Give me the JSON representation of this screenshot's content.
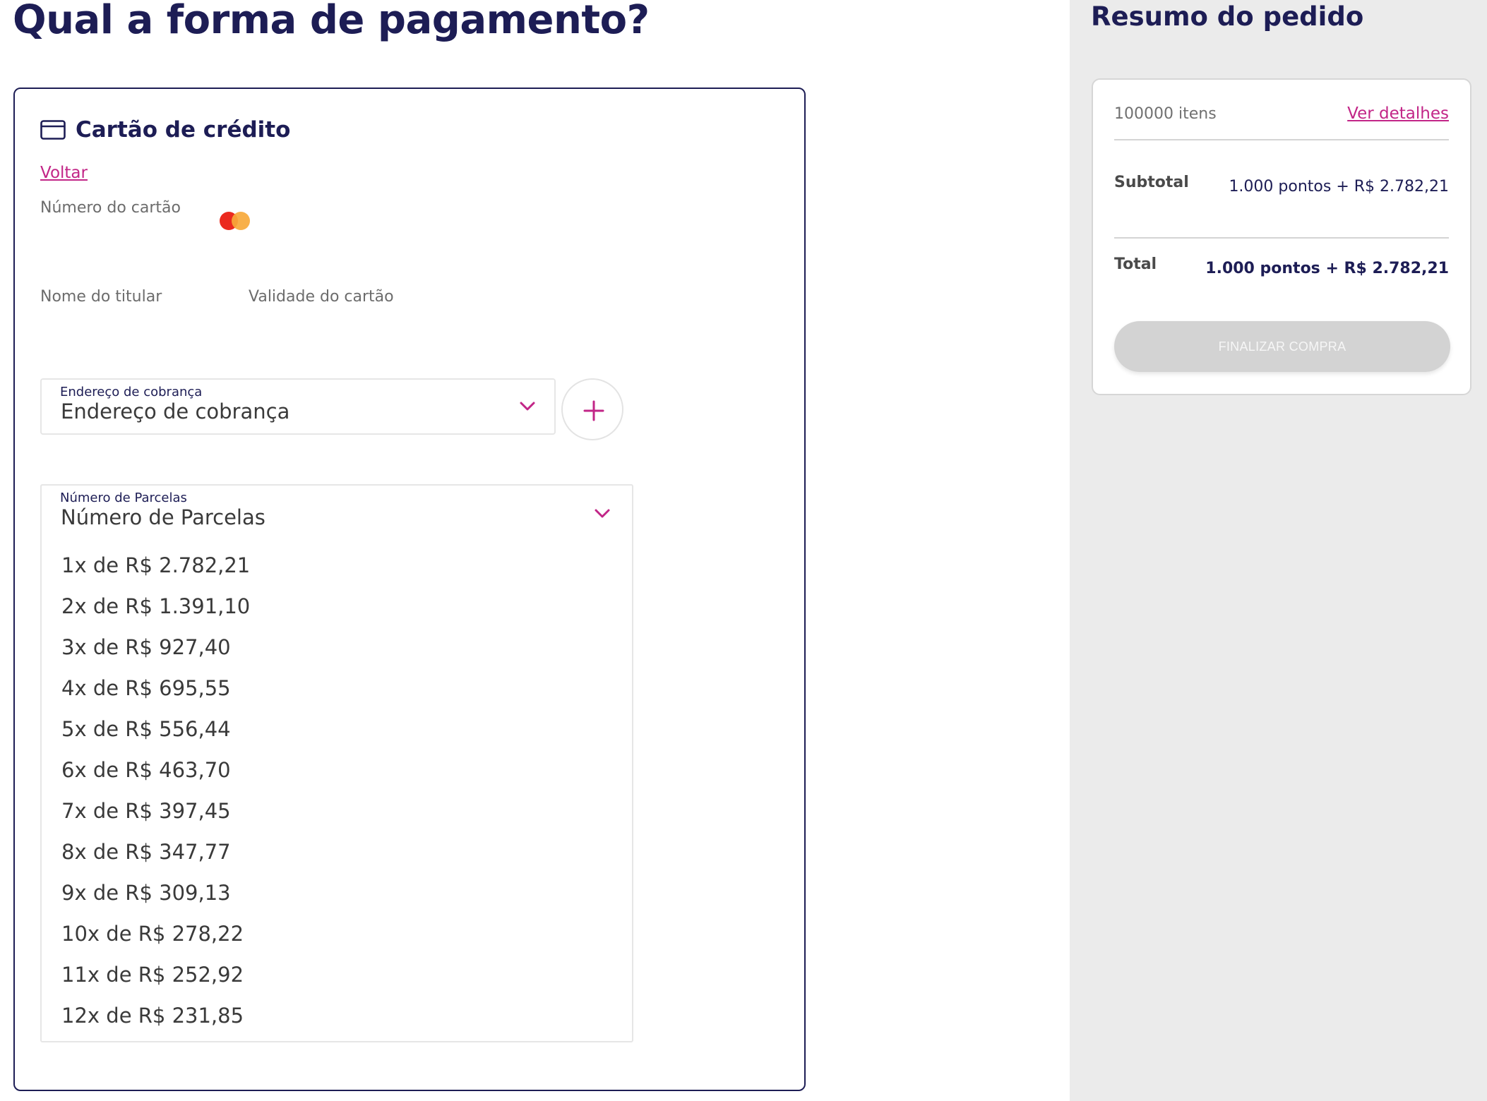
{
  "page": {
    "title": "Qual a forma de pagamento?"
  },
  "payment": {
    "method_title": "Cartão de crédito",
    "method_icon": "credit-card-icon",
    "back_link": "Voltar",
    "card_number_label": "Número do cartão",
    "card_brand": "mastercard",
    "holder_label": "Nome do titular",
    "validity_label": "Validade do cartão",
    "billing_address": {
      "label": "Endereço de cobrança",
      "value": "Endereço de cobrança"
    },
    "add_address_icon": "plus-icon",
    "installments": {
      "label": "Número de Parcelas",
      "value": "Número de Parcelas",
      "options": [
        "1x de R$ 2.782,21",
        "2x de R$ 1.391,10",
        "3x de R$ 927,40",
        "4x de R$ 695,55",
        "5x de R$ 556,44",
        "6x de R$ 463,70",
        "7x de R$ 397,45",
        "8x de R$ 347,77",
        "9x de R$ 309,13",
        "10x de R$ 278,22",
        "11x de R$ 252,92",
        "12x de R$ 231,85"
      ]
    }
  },
  "summary": {
    "title": "Resumo do pedido",
    "items_count": "100000 itens",
    "details_link": "Ver detalhes",
    "subtotal_label": "Subtotal",
    "subtotal_value": "1.000 pontos + R$ 2.782,21",
    "total_label": "Total",
    "total_value": "1.000 pontos + R$ 2.782,21",
    "checkout_button": "FINALIZAR COMPRA",
    "checkout_enabled": false
  },
  "colors": {
    "primary_text": "#1d1d55",
    "accent": "#c22587",
    "sidebar_bg": "#ebebeb",
    "disabled_button": "#d3d3d3"
  }
}
